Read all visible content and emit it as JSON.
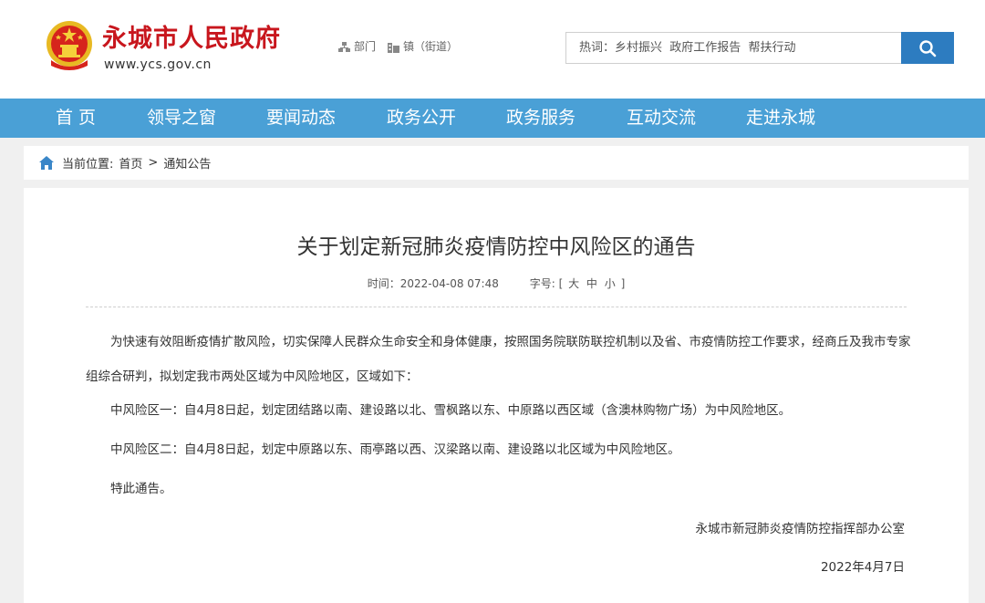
{
  "header": {
    "site_title": "永城市人民政府",
    "site_url": "www.ycs.gov.cn",
    "links": {
      "department": "部门",
      "town": "镇（街道）"
    },
    "search": {
      "placeholder": "热词：乡村振兴  政府工作报告  帮扶行动"
    }
  },
  "nav": {
    "items": [
      "首 页",
      "领导之窗",
      "要闻动态",
      "政务公开",
      "政务服务",
      "互动交流",
      "走进永城"
    ]
  },
  "breadcrumb": {
    "label": "当前位置:",
    "home": "首页",
    "separator": ">",
    "current": "通知公告"
  },
  "article": {
    "title": "关于划定新冠肺炎疫情防控中风险区的通告",
    "time_label": "时间：",
    "time_value": "2022-04-08 07:48",
    "font_size_label": "字号:",
    "font_size_open": "[",
    "font_sizes": [
      "大",
      "中",
      "小"
    ],
    "font_size_close": "]",
    "paragraphs": [
      "为快速有效阻断疫情扩散风险，切实保障人民群众生命安全和身体健康，按照国务院联防联控机制以及省、市疫情防控工作要求，经商丘及我市专家组综合研判，拟划定我市两处区域为中风险地区，区域如下：",
      "中风险区一：自4月8日起，划定团结路以南、建设路以北、雪枫路以东、中原路以西区域（含澳林购物广场）为中风险地区。",
      "中风险区二：自4月8日起，划定中原路以东、雨亭路以西、汉梁路以南、建设路以北区域为中风险地区。",
      "特此通告。"
    ],
    "signature": "永城市新冠肺炎疫情防控指挥部办公室",
    "date": "2022年4月7日"
  },
  "colors": {
    "brand_red": "#c8161d",
    "nav_blue": "#4aa0d6",
    "search_button": "#2d7cc0"
  },
  "icons": [
    "national-emblem-icon",
    "department-icon",
    "town-icon",
    "search-icon",
    "home-icon"
  ]
}
